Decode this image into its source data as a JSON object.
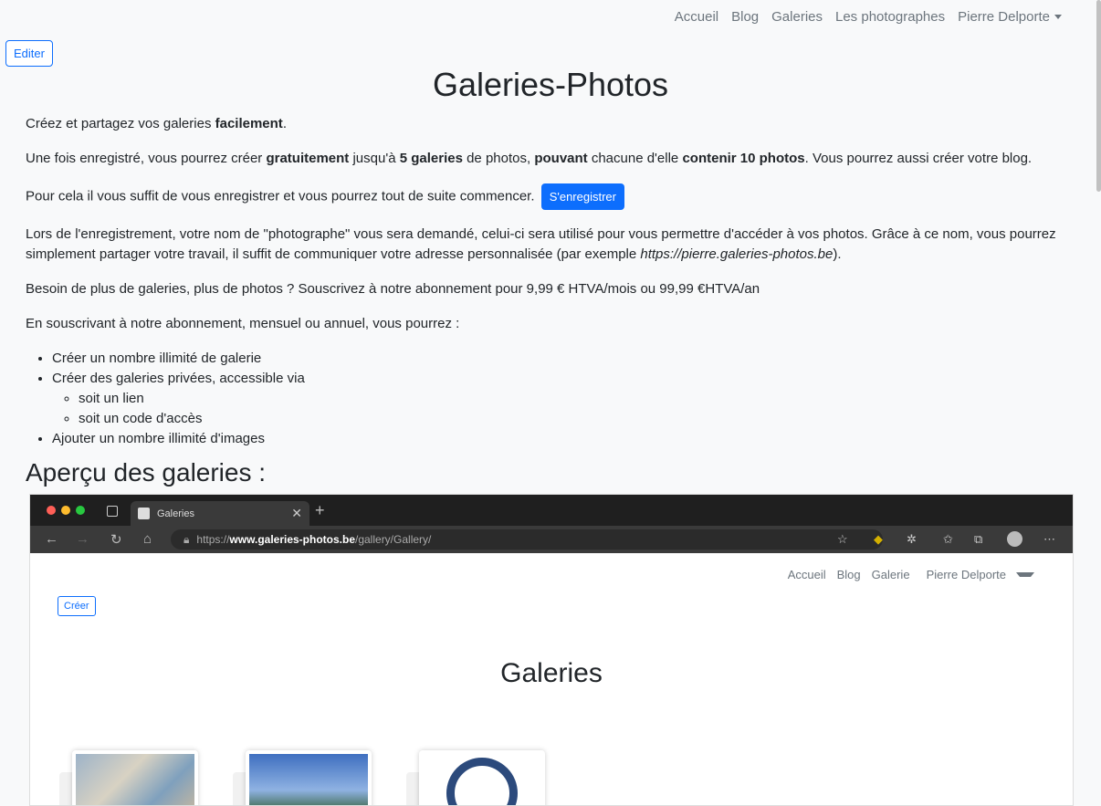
{
  "nav": {
    "items": [
      "Accueil",
      "Blog",
      "Galeries",
      "Les photographes"
    ],
    "user": "Pierre Delporte"
  },
  "edit_button": "Editer",
  "title": "Galeries-Photos",
  "intro": {
    "p1": {
      "a": "Créez et partagez vos galeries ",
      "b": "facilement",
      "c": "."
    },
    "p2": {
      "a": "Une fois enregistré, vous pourrez créer ",
      "b": "gratuitement",
      "c": " jusqu'à ",
      "d": "5 galeries",
      "e": " de photos, ",
      "f": "pouvant",
      "g": " chacune d'elle ",
      "h": "contenir 10 photos",
      "i": ". Vous pourrez aussi créer votre blog."
    },
    "p3": "Pour cela il vous suffit de vous enregistrer et vous pourrez tout de suite commencer.",
    "register_button": "S'enregistrer",
    "p4": {
      "a": "Lors de l'enregistrement, votre nom de \"photographe\" vous sera demandé, celui-ci sera utilisé pour vous permettre d'accéder à vos photos. Grâce à ce nom, vous pourrez simplement partager votre travail, il suffit de communiquer votre adresse personnalisée (par exemple ",
      "b": "https://pierre.galeries-photos.be",
      "c": ")."
    },
    "p5": "Besoin de plus de galeries, plus de photos ? Souscrivez à notre abonnement pour 9,99 € HTVA/mois ou 99,99 €HTVA/an",
    "p6": "En souscrivant à notre abonnement, mensuel ou annuel, vous pourrez :",
    "list": {
      "i1": "Créer un nombre illimité de galerie",
      "i2": "Créer des galeries privées, accessible via",
      "sub1": "soit un lien",
      "sub2": "soit un code d'accès",
      "i3": "Ajouter un nombre illimité d'images"
    }
  },
  "preview_heading": "Aperçu des galeries :",
  "screenshot": {
    "tab_title": "Galeries",
    "url_prefix": "https://",
    "url_host": "www.galeries-photos.be",
    "url_path": "/gallery/Gallery/",
    "nav": [
      "Accueil",
      "Blog",
      "Galerie"
    ],
    "user": "Pierre Delporte",
    "create_button": "Créer",
    "title": "Galeries"
  },
  "colors": {
    "accent": "#0d6efd",
    "background": "#f8f9fa",
    "browser_dark": "#1f1f1f"
  }
}
